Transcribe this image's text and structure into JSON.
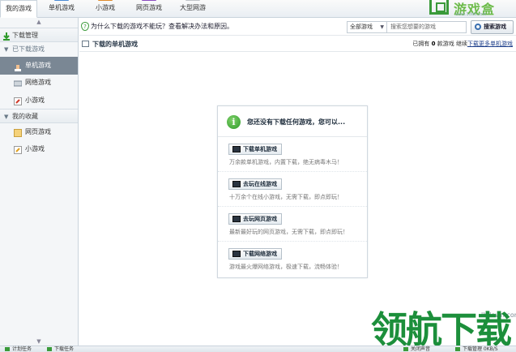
{
  "tabs": [
    {
      "label": "我的游戏",
      "active": true
    },
    {
      "label": "单机游戏"
    },
    {
      "label": "小游戏"
    },
    {
      "label": "网页游戏"
    },
    {
      "label": "大型网游"
    }
  ],
  "logo": {
    "text": "游戏盒",
    "url": "www.1ddd.com"
  },
  "sidebar": {
    "header": "下载管理",
    "sections": [
      {
        "label": "已下载游戏",
        "items": [
          "单机游戏",
          "网络游戏",
          "小游戏"
        ]
      },
      {
        "label": "我的收藏",
        "items": [
          "网页游戏",
          "小游戏"
        ]
      }
    ]
  },
  "infobar": {
    "text": "为什么下载的游戏不能玩？查看解决办法和原因。",
    "filter": "全部游戏",
    "search_placeholder": "搜索您想要的游戏",
    "search_button": "搜索游戏"
  },
  "titlebar": {
    "title": "下载的单机游戏",
    "stats_prefix": "已拥有",
    "count": "0",
    "stats_suffix": "款游戏 继续",
    "link": "下载更多单机游戏"
  },
  "empty": {
    "message": "您还没有下载任何游戏，您可以...",
    "options": [
      {
        "button": "下载单机游戏",
        "desc": "万余款单机游戏，内置下载，绝无病毒木马！"
      },
      {
        "button": "去玩在线游戏",
        "desc": "十万余个在线小游戏，无需下载，即点即玩！"
      },
      {
        "button": "去玩网页游戏",
        "desc": "最新最好玩的网页游戏，无需下载，即点即玩！"
      },
      {
        "button": "下载网络游戏",
        "desc": "游戏最火爆网络游戏，极速下载，流畅体验！"
      }
    ]
  },
  "statusbar": {
    "left1": "计划任务",
    "left2": "下载任务",
    "right1": "关闭声音",
    "right2": "下载管理 0KB/S"
  },
  "watermark": {
    "url": "lhdown.com",
    "text": "领航下载"
  },
  "colors": {
    "accent_green": "#3a9a3a",
    "sidebar_selected": "#7a8794",
    "link": "#1c3e8a"
  }
}
